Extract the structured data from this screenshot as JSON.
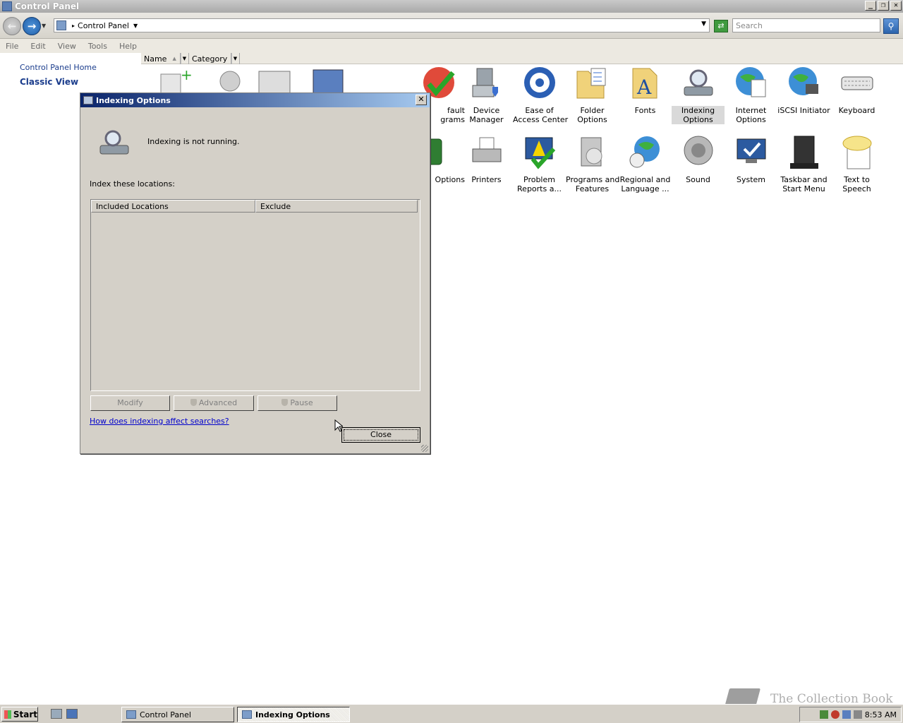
{
  "window": {
    "title": "Control Panel",
    "buttons": {
      "minimize": "_",
      "restore": "❐",
      "close": "✕"
    }
  },
  "address": {
    "location": "Control Panel",
    "search_placeholder": "Search"
  },
  "menu": [
    "File",
    "Edit",
    "View",
    "Tools",
    "Help"
  ],
  "sidebar": {
    "home": "Control Panel Home",
    "classic": "Classic View"
  },
  "columns": {
    "name": "Name",
    "category": "Category"
  },
  "items_row1": [
    {
      "label": "fault\ngrams",
      "icon": "default-programs-icon"
    },
    {
      "label": "Device\nManager",
      "icon": "device-manager-icon"
    },
    {
      "label": "Ease of\nAccess Center",
      "icon": "ease-of-access-icon"
    },
    {
      "label": "Folder Options",
      "icon": "folder-options-icon"
    },
    {
      "label": "Fonts",
      "icon": "fonts-icon"
    },
    {
      "label": "Indexing\nOptions",
      "icon": "indexing-options-icon"
    },
    {
      "label": "Internet\nOptions",
      "icon": "internet-options-icon"
    },
    {
      "label": "iSCSI Initiator",
      "icon": "iscsi-initiator-icon"
    },
    {
      "label": "Keyboard",
      "icon": "keyboard-icon"
    }
  ],
  "items_row2": [
    {
      "label": "Options",
      "icon": "power-options-icon"
    },
    {
      "label": "Printers",
      "icon": "printers-icon"
    },
    {
      "label": "Problem\nReports a...",
      "icon": "problem-reports-icon"
    },
    {
      "label": "Programs and\nFeatures",
      "icon": "programs-features-icon"
    },
    {
      "label": "Regional and\nLanguage ...",
      "icon": "regional-language-icon"
    },
    {
      "label": "Sound",
      "icon": "sound-icon"
    },
    {
      "label": "System",
      "icon": "system-icon"
    },
    {
      "label": "Taskbar and\nStart Menu",
      "icon": "taskbar-start-menu-icon"
    },
    {
      "label": "Text to\nSpeech",
      "icon": "text-to-speech-icon"
    }
  ],
  "dialog": {
    "title": "Indexing Options",
    "status": "Indexing is not running.",
    "index_label": "Index these locations:",
    "col_included": "Included Locations",
    "col_exclude": "Exclude",
    "btn_modify": "Modify",
    "btn_advanced": "Advanced",
    "btn_pause": "Pause",
    "help_link": "How does indexing affect searches?",
    "btn_close": "Close"
  },
  "taskbar": {
    "start": "Start",
    "task1": "Control Panel",
    "task2": "Indexing Options",
    "clock": "8:53 AM"
  },
  "watermark": "The Collection Book",
  "colors": {
    "dialog_title_start": "#0a246a",
    "dialog_title_end": "#a6caf0",
    "link": "#0000cc",
    "sidebar_link": "#1a3c8c"
  }
}
